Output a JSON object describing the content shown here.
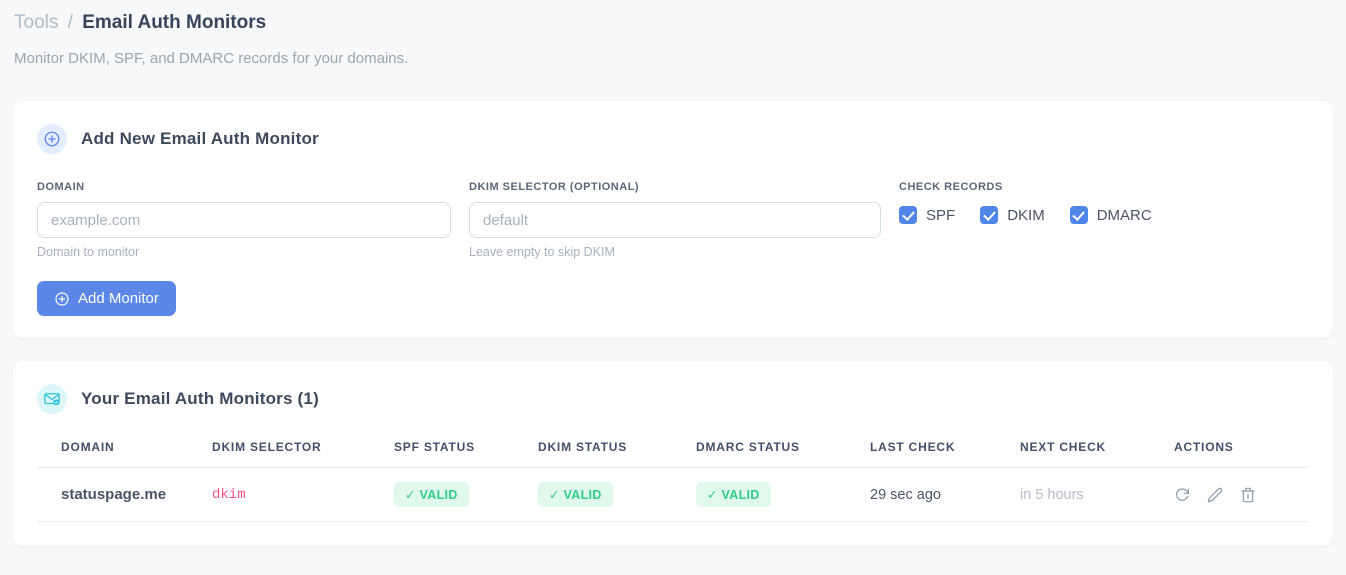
{
  "page": {
    "breadcrumb": {
      "section": "Tools",
      "separator": "/",
      "current": "Email Auth Monitors"
    },
    "subtitle": "Monitor DKIM, SPF, and DMARC records for your domains."
  },
  "add_form": {
    "title": "Add New Email Auth Monitor",
    "header_icon": "plus-circle-icon",
    "fields": {
      "domain": {
        "label": "DOMAIN",
        "placeholder": "example.com",
        "value": "",
        "helper": "Domain to monitor"
      },
      "dkim_selector": {
        "label": "DKIM SELECTOR (OPTIONAL)",
        "placeholder": "default",
        "value": "",
        "helper": "Leave empty to skip DKIM"
      }
    },
    "check_records": {
      "label": "CHECK RECORDS",
      "options": [
        {
          "label": "SPF",
          "checked": true
        },
        {
          "label": "DKIM",
          "checked": true
        },
        {
          "label": "DMARC",
          "checked": true
        }
      ]
    },
    "submit_label": "Add Monitor",
    "submit_icon": "plus-circle-icon"
  },
  "monitors": {
    "title": "Your Email Auth Monitors (1)",
    "count": 1,
    "header_icon": "mail-check-icon",
    "table": {
      "columns": [
        "DOMAIN",
        "DKIM SELECTOR",
        "SPF STATUS",
        "DKIM STATUS",
        "DMARC STATUS",
        "LAST CHECK",
        "NEXT CHECK",
        "ACTIONS"
      ],
      "rows": [
        {
          "domain": "statuspage.me",
          "dkim_selector": "dkim",
          "spf_status": "✓ VALID",
          "dkim_status": "✓ VALID",
          "dmarc_status": "✓ VALID",
          "last_check": "29 sec ago",
          "next_check": "in 5 hours",
          "action_icons": [
            "refresh-icon",
            "edit-pencil-icon",
            "trash-icon"
          ]
        }
      ]
    }
  },
  "colors": {
    "accent_blue": "#5b87e8",
    "checkbox_blue": "#4f86e8",
    "badge_green_bg": "#e1f8ec",
    "badge_green_text": "#2fcc8b",
    "selector_pink": "#f25289",
    "icon_cyan": "#28c3d7",
    "page_background": "#f7f8f9"
  }
}
